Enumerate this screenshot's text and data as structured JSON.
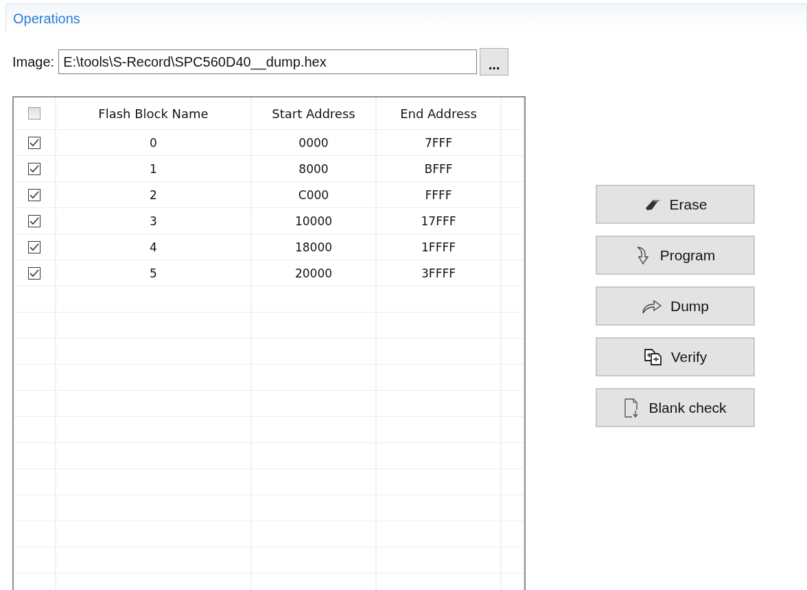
{
  "panel": {
    "title": "Operations"
  },
  "image": {
    "label": "Image:",
    "value": "E:\\tools\\S-Record\\SPC560D40__dump.hex",
    "browse": "..."
  },
  "table": {
    "header_checked": false,
    "columns": [
      "Flash Block Name",
      "Start Address",
      "End Address"
    ],
    "rows": [
      {
        "checked": true,
        "cells": [
          "0",
          "0000",
          "7FFF"
        ]
      },
      {
        "checked": true,
        "cells": [
          "1",
          "8000",
          "BFFF"
        ]
      },
      {
        "checked": true,
        "cells": [
          "2",
          "C000",
          "FFFF"
        ]
      },
      {
        "checked": true,
        "cells": [
          "3",
          "10000",
          "17FFF"
        ]
      },
      {
        "checked": true,
        "cells": [
          "4",
          "18000",
          "1FFFF"
        ]
      },
      {
        "checked": true,
        "cells": [
          "5",
          "20000",
          "3FFFF"
        ]
      }
    ]
  },
  "buttons": [
    {
      "kind": "erase",
      "label": "Erase"
    },
    {
      "kind": "program",
      "label": "Program"
    },
    {
      "kind": "dump",
      "label": "Dump"
    },
    {
      "kind": "verify",
      "label": "Verify"
    },
    {
      "kind": "blank",
      "label": "Blank check"
    }
  ]
}
